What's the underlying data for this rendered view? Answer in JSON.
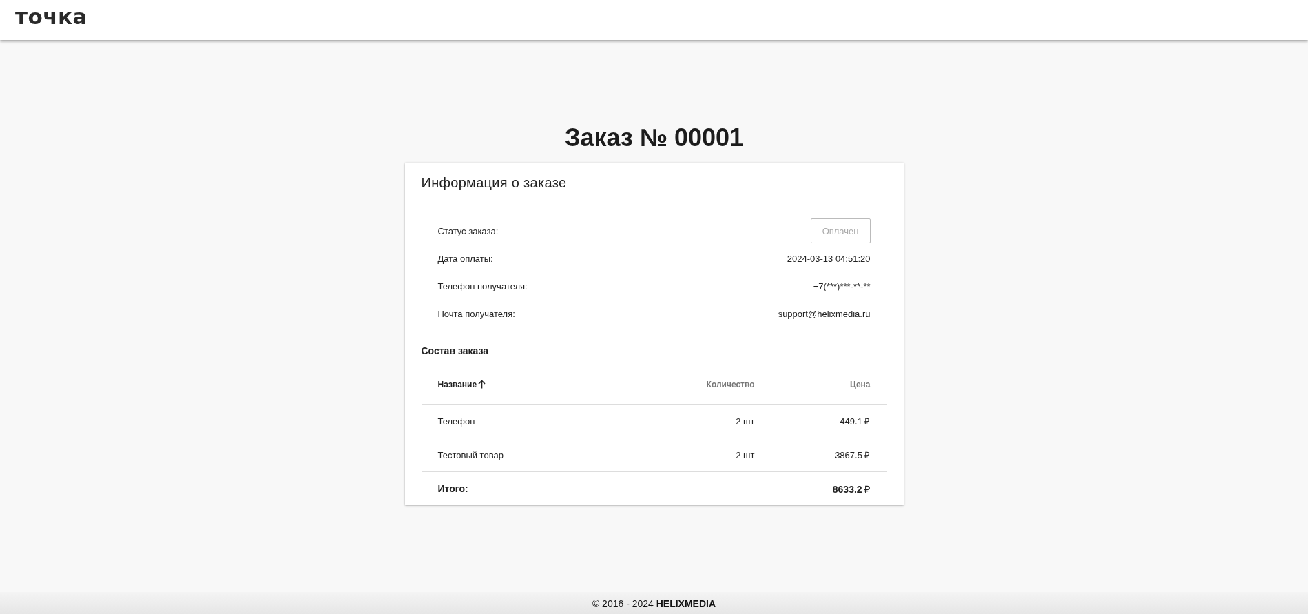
{
  "header": {
    "logo": "точка"
  },
  "page_title": "Заказ № 00001",
  "card": {
    "title": "Информация о заказе",
    "fields": [
      {
        "label": "Статус заказа:",
        "kind": "status",
        "value": "Оплачен",
        "disabled": true
      },
      {
        "label": "Дата оплаты:",
        "kind": "text",
        "value": "2024-03-13 04:51:20"
      },
      {
        "label": "Телефон получателя:",
        "kind": "text",
        "value": "+7(***)***-**-**"
      },
      {
        "label": "Почта получателя:",
        "kind": "text",
        "value": "support@helixmedia.ru"
      }
    ],
    "items_title": "Состав заказа",
    "table": {
      "columns": [
        {
          "label": "Название",
          "sorted": true
        },
        {
          "label": "Количество",
          "sorted": false
        },
        {
          "label": "Цена",
          "sorted": false
        }
      ],
      "rows": [
        [
          "Телефон",
          "2 шт",
          "449.1 ₽"
        ],
        [
          "Тестовый товар",
          "2 шт",
          "3867.5 ₽"
        ]
      ],
      "total": {
        "label": "Итого:",
        "value": "8633.2 ₽"
      }
    }
  },
  "footer": {
    "text": "© 2016 - 2024 **HELIXMEDIA**"
  }
}
